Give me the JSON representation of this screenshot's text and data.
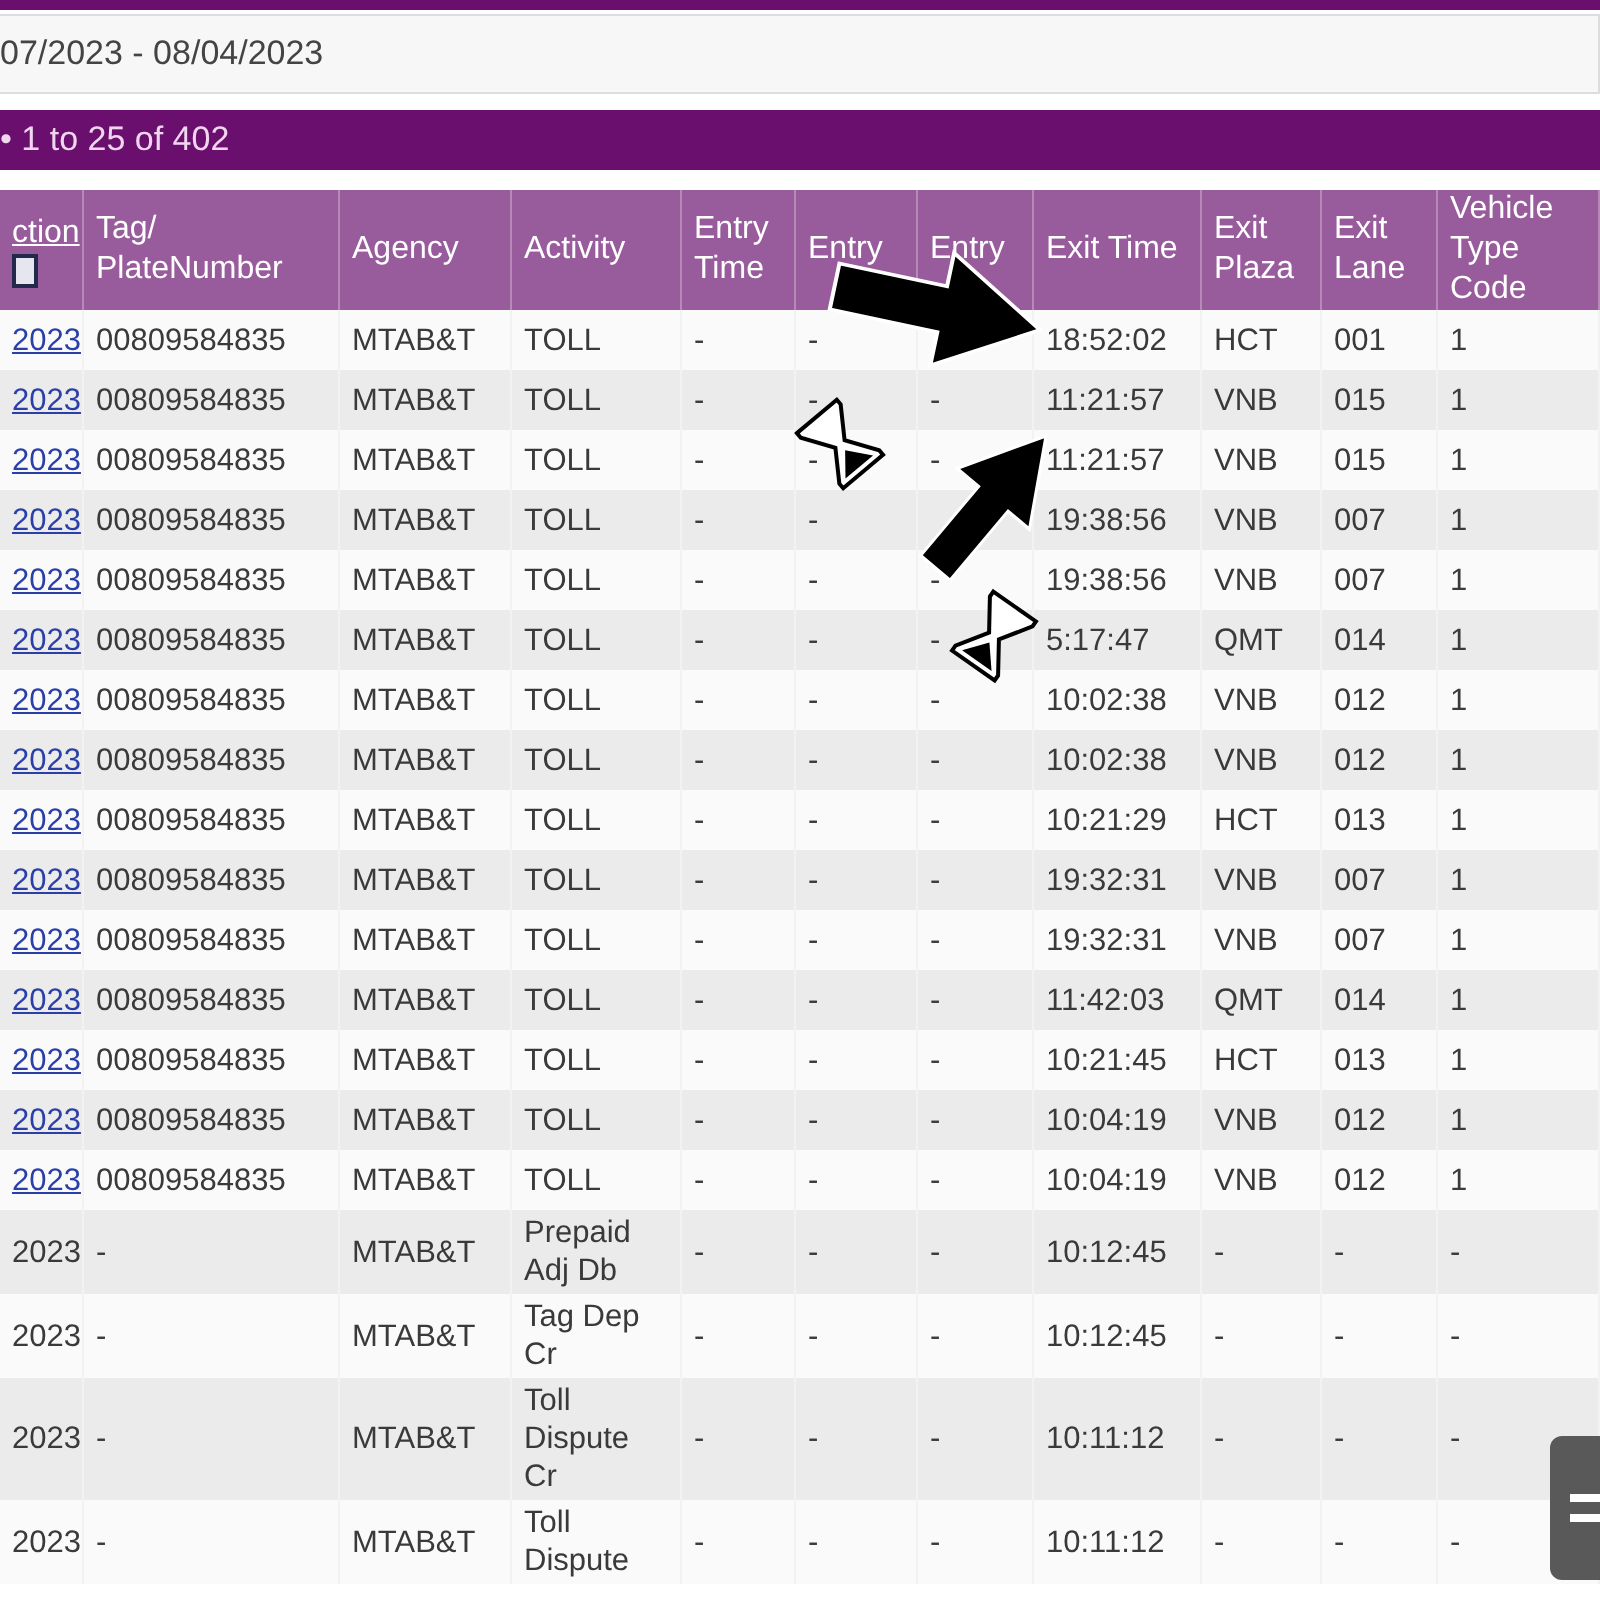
{
  "date_range": "07/2023 - 08/04/2023",
  "results_bar": "• 1 to 25 of 402",
  "columns": [
    "ction",
    "Tag/ PlateNumber",
    "Agency",
    "Activity",
    "Entry Time",
    "Entry",
    "Entry",
    "Exit Time",
    "Exit Plaza",
    "Exit Lane",
    "Vehicle Type Code"
  ],
  "rows": [
    {
      "date_link": true,
      "cells": [
        "2023",
        "00809584835",
        "MTAB&T",
        "TOLL",
        "-",
        "-",
        null,
        "18:52:02",
        "HCT",
        "001",
        "1"
      ]
    },
    {
      "date_link": true,
      "cells": [
        "2023",
        "00809584835",
        "MTAB&T",
        "TOLL",
        "-",
        "-",
        "-",
        "11:21:57",
        "VNB",
        "015",
        "1"
      ]
    },
    {
      "date_link": true,
      "cells": [
        "2023",
        "00809584835",
        "MTAB&T",
        "TOLL",
        "-",
        "-",
        "-",
        "11:21:57",
        "VNB",
        "015",
        "1"
      ]
    },
    {
      "date_link": true,
      "cells": [
        "2023",
        "00809584835",
        "MTAB&T",
        "TOLL",
        "-",
        "-",
        null,
        "19:38:56",
        "VNB",
        "007",
        "1"
      ]
    },
    {
      "date_link": true,
      "cells": [
        "2023",
        "00809584835",
        "MTAB&T",
        "TOLL",
        "-",
        "-",
        "-",
        "19:38:56",
        "VNB",
        "007",
        "1"
      ]
    },
    {
      "date_link": true,
      "cells": [
        "2023",
        "00809584835",
        "MTAB&T",
        "TOLL",
        "-",
        "-",
        "-",
        "5:17:47",
        "QMT",
        "014",
        "1"
      ]
    },
    {
      "date_link": true,
      "cells": [
        "2023",
        "00809584835",
        "MTAB&T",
        "TOLL",
        "-",
        "-",
        "-",
        "10:02:38",
        "VNB",
        "012",
        "1"
      ]
    },
    {
      "date_link": true,
      "cells": [
        "2023",
        "00809584835",
        "MTAB&T",
        "TOLL",
        "-",
        "-",
        "-",
        "10:02:38",
        "VNB",
        "012",
        "1"
      ]
    },
    {
      "date_link": true,
      "cells": [
        "2023",
        "00809584835",
        "MTAB&T",
        "TOLL",
        "-",
        "-",
        "-",
        "10:21:29",
        "HCT",
        "013",
        "1"
      ]
    },
    {
      "date_link": true,
      "cells": [
        "2023",
        "00809584835",
        "MTAB&T",
        "TOLL",
        "-",
        "-",
        "-",
        "19:32:31",
        "VNB",
        "007",
        "1"
      ]
    },
    {
      "date_link": true,
      "cells": [
        "2023",
        "00809584835",
        "MTAB&T",
        "TOLL",
        "-",
        "-",
        "-",
        "19:32:31",
        "VNB",
        "007",
        "1"
      ]
    },
    {
      "date_link": true,
      "cells": [
        "2023",
        "00809584835",
        "MTAB&T",
        "TOLL",
        "-",
        "-",
        "-",
        "11:42:03",
        "QMT",
        "014",
        "1"
      ]
    },
    {
      "date_link": true,
      "cells": [
        "2023",
        "00809584835",
        "MTAB&T",
        "TOLL",
        "-",
        "-",
        "-",
        "10:21:45",
        "HCT",
        "013",
        "1"
      ]
    },
    {
      "date_link": true,
      "cells": [
        "2023",
        "00809584835",
        "MTAB&T",
        "TOLL",
        "-",
        "-",
        "-",
        "10:04:19",
        "VNB",
        "012",
        "1"
      ]
    },
    {
      "date_link": true,
      "cells": [
        "2023",
        "00809584835",
        "MTAB&T",
        "TOLL",
        "-",
        "-",
        "-",
        "10:04:19",
        "VNB",
        "012",
        "1"
      ]
    },
    {
      "date_link": false,
      "cells": [
        "2023",
        "-",
        "MTAB&T",
        "Prepaid Adj Db",
        "-",
        "-",
        "-",
        "10:12:45",
        "-",
        "-",
        "-"
      ]
    },
    {
      "date_link": false,
      "cells": [
        "2023",
        "-",
        "MTAB&T",
        "Tag Dep Cr",
        "-",
        "-",
        "-",
        "10:12:45",
        "-",
        "-",
        "-"
      ]
    },
    {
      "date_link": false,
      "cells": [
        "2023",
        "-",
        "MTAB&T",
        "Toll Dispute Cr",
        "-",
        "-",
        "-",
        "10:11:12",
        "-",
        "-",
        "-"
      ]
    },
    {
      "date_link": false,
      "cells": [
        "2023",
        "-",
        "MTAB&T",
        "Toll Dispute",
        "-",
        "-",
        "-",
        "10:11:12",
        "-",
        "-",
        "-"
      ]
    }
  ],
  "annotations": [
    {
      "kind": "arrow"
    },
    {
      "kind": "arrow"
    },
    {
      "kind": "hourglass"
    },
    {
      "kind": "hourglass"
    }
  ]
}
